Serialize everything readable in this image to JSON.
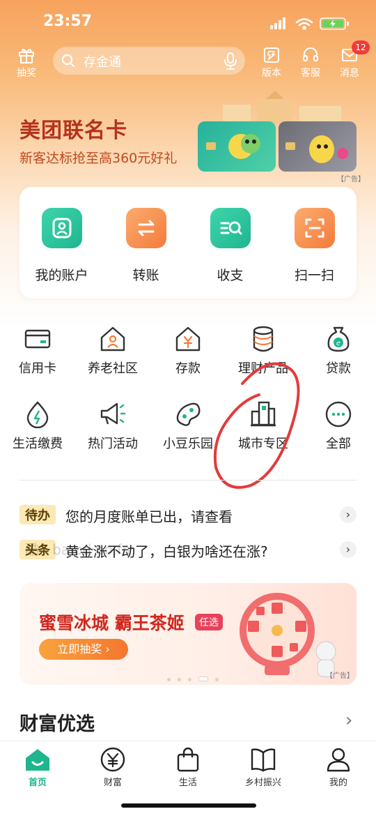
{
  "status_bar": {
    "time": "23:57"
  },
  "top_bar": {
    "lottery_label": "抽奖",
    "search_placeholder": "存金通",
    "version_label": "版本",
    "service_label": "客服",
    "messages_label": "消息",
    "messages_badge": "12"
  },
  "banner": {
    "title": "美团联名卡",
    "subtitle": "新客达标抢至高360元好礼",
    "ad_label": "【广告】"
  },
  "quick_actions": [
    {
      "label": "我的账户",
      "icon": "account-icon",
      "color": "#2bc49b"
    },
    {
      "label": "转账",
      "icon": "transfer-icon",
      "color": "#f68a4c"
    },
    {
      "label": "收支",
      "icon": "income-expense-icon",
      "color": "#2bc49b"
    },
    {
      "label": "扫一扫",
      "icon": "scan-icon",
      "color": "#f68a4c"
    }
  ],
  "services": [
    {
      "label": "信用卡",
      "icon": "credit-card-icon"
    },
    {
      "label": "养老社区",
      "icon": "elderly-community-icon"
    },
    {
      "label": "存款",
      "icon": "deposit-icon"
    },
    {
      "label": "理财产品",
      "icon": "wealth-products-icon"
    },
    {
      "label": "贷款",
      "icon": "loan-icon"
    },
    {
      "label": "生活缴费",
      "icon": "utility-payment-icon"
    },
    {
      "label": "热门活动",
      "icon": "hot-events-icon"
    },
    {
      "label": "小豆乐园",
      "icon": "bean-park-icon"
    },
    {
      "label": "城市专区",
      "icon": "city-zone-icon"
    },
    {
      "label": "全部",
      "icon": "more-icon"
    }
  ],
  "notices": [
    {
      "tag": "待办",
      "text": "您的月度账单已出，请查看"
    },
    {
      "tag": "头条",
      "text": "黄金涨不动了，白银为啥还在涨?"
    }
  ],
  "watermark": "酷 · ba·od·ao.fm",
  "promo": {
    "title": "蜜雪冰城 霸王茶姬",
    "tag": "任选",
    "button": "立即抽奖 ›",
    "ad_label": "【广告】"
  },
  "wealth_section": {
    "title": "财富优选"
  },
  "tab_bar": [
    {
      "label": "首页",
      "icon": "home-icon",
      "active": true
    },
    {
      "label": "财富",
      "icon": "wealth-icon",
      "active": false
    },
    {
      "label": "生活",
      "icon": "life-bag-icon",
      "active": false
    },
    {
      "label": "乡村振兴",
      "icon": "rural-book-icon",
      "active": false
    },
    {
      "label": "我的",
      "icon": "profile-icon",
      "active": false
    }
  ],
  "colors": {
    "brand_green": "#1fb58f",
    "accent_orange": "#f68a4c",
    "annotation_red": "#e23b3b"
  }
}
